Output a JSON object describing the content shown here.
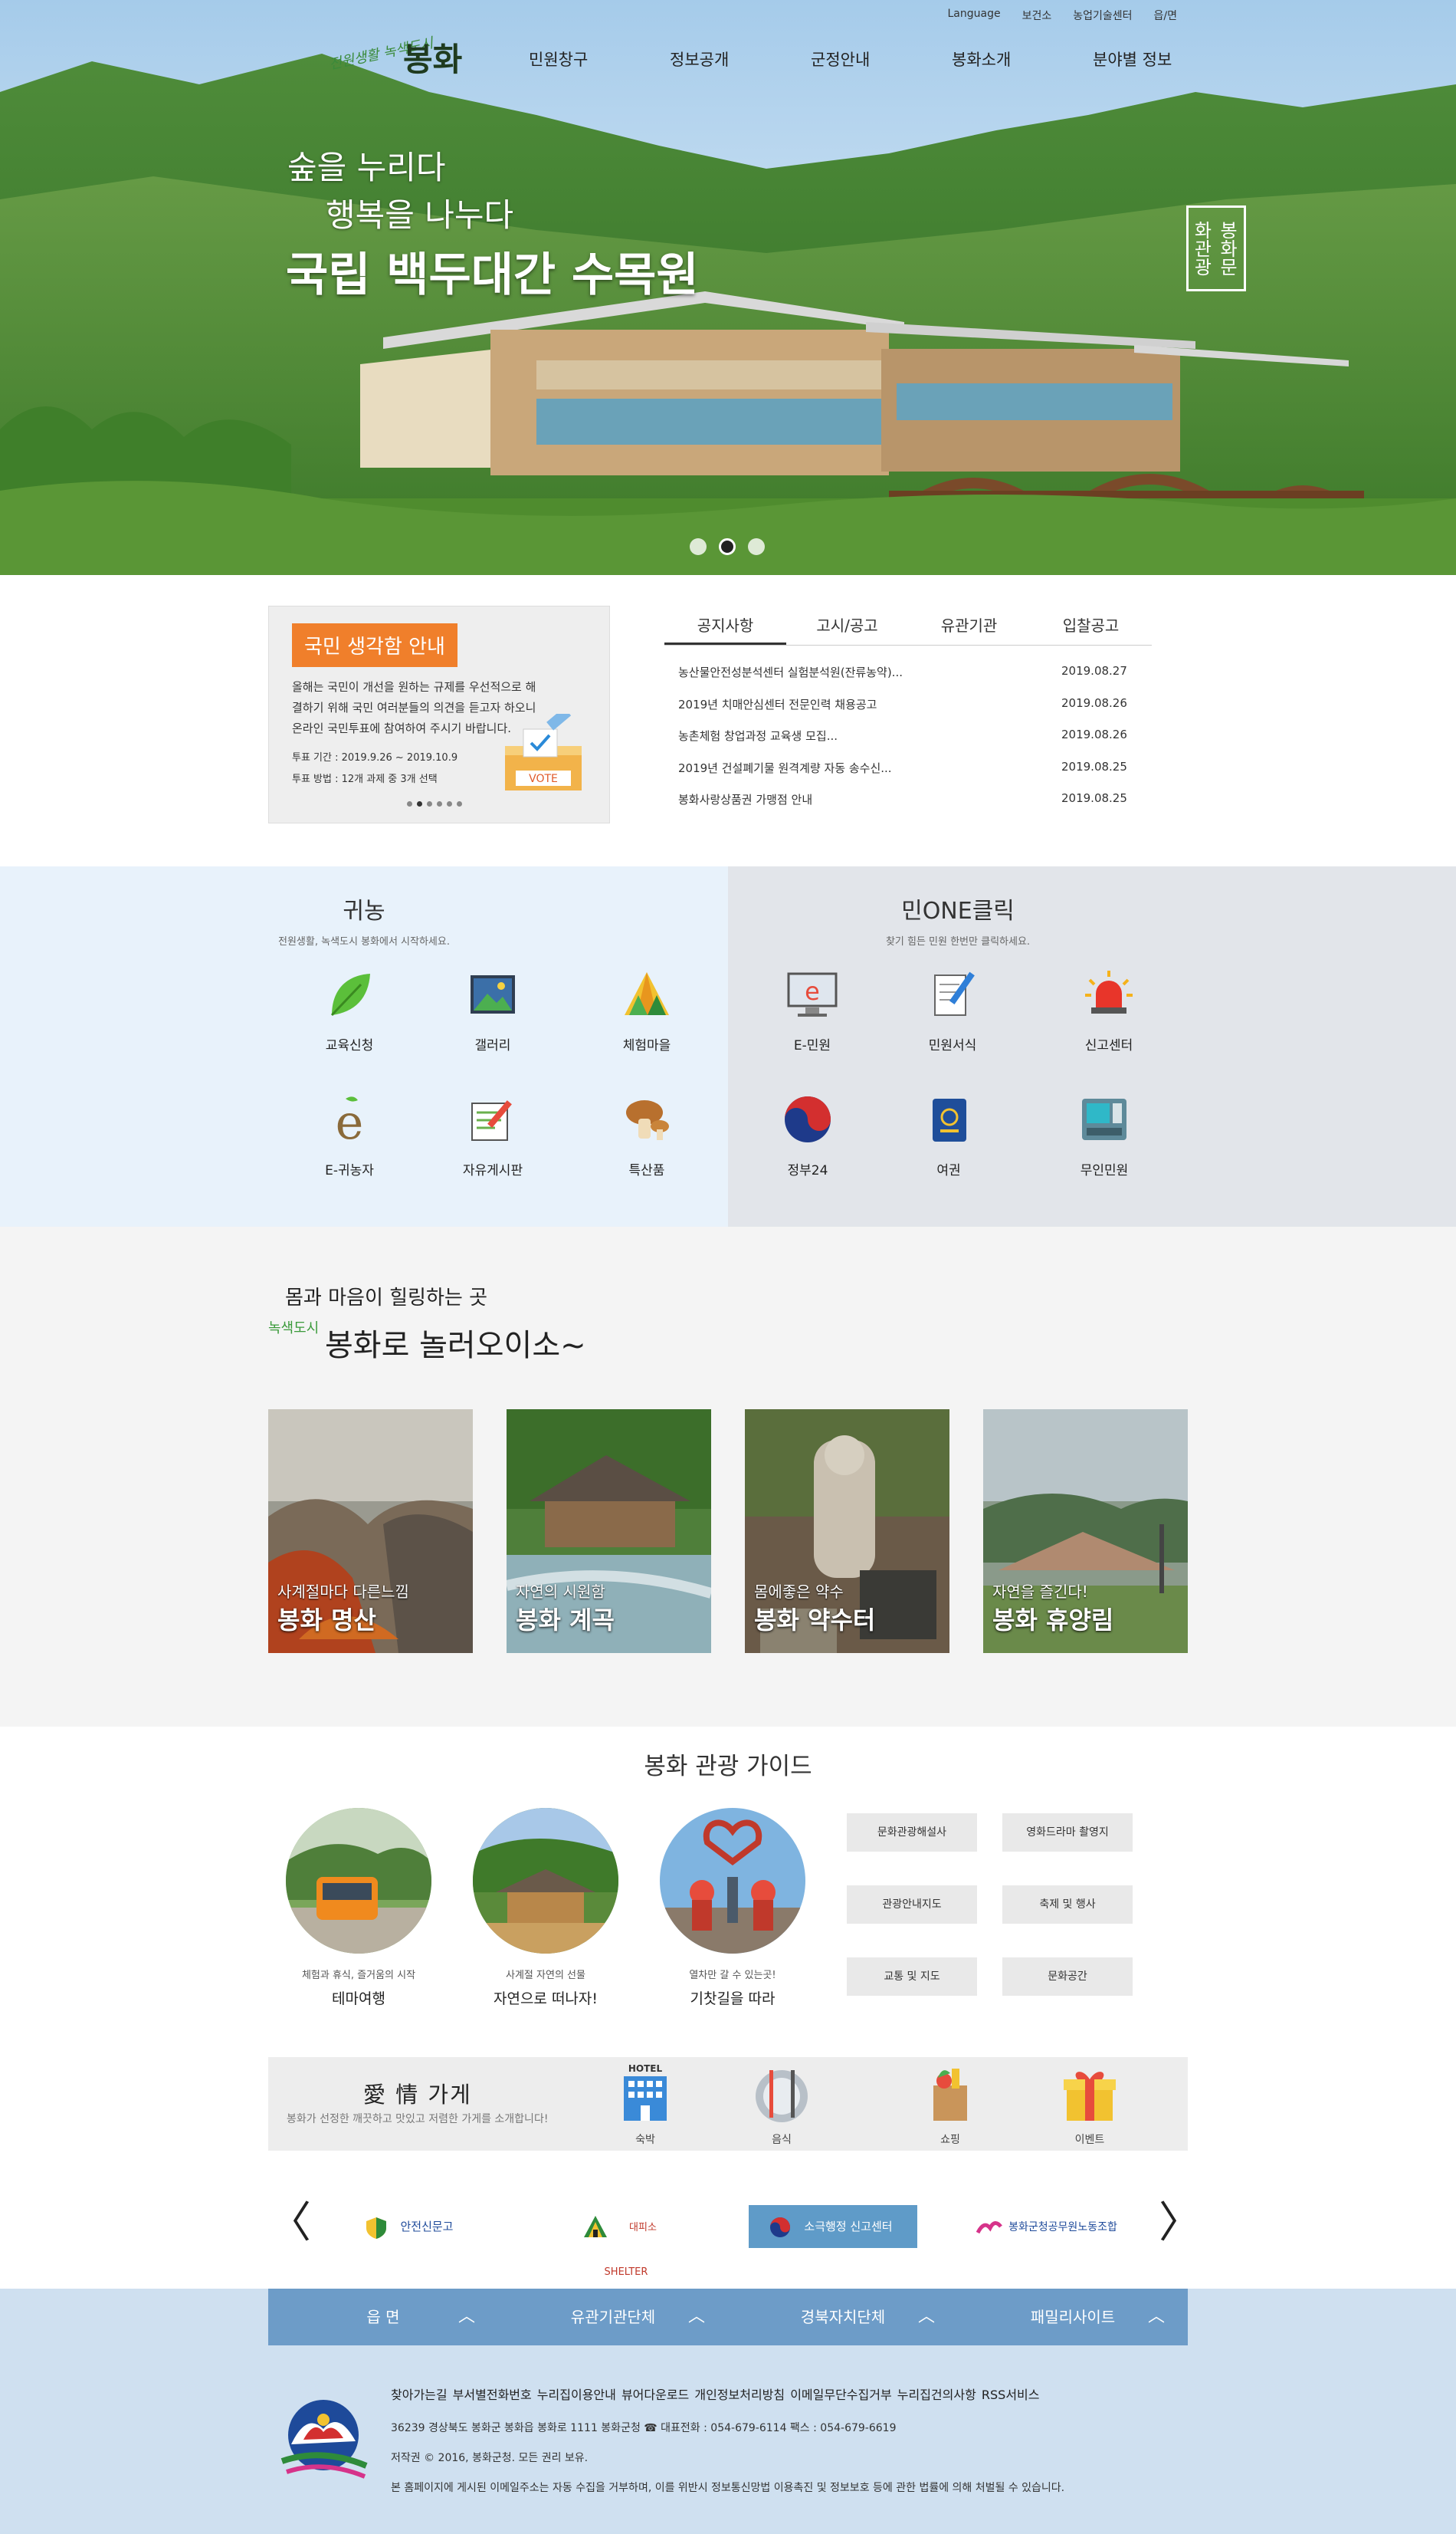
{
  "header": {
    "utility_links": [
      "Language",
      "보건소",
      "농업기술센터",
      "읍/면"
    ],
    "logo_script": "전원생활 녹색도시",
    "logo_text": "봉화",
    "gnb": [
      "민원창구",
      "정보공개",
      "군정안내",
      "봉화소개",
      "분야별 정보"
    ]
  },
  "hero": {
    "line1": "숲을 누리다",
    "line2": "행복을 나누다",
    "line3": "국립 백두대간 수목원",
    "stamp": "봉화문화관광",
    "slide_count": 3,
    "active_slide": 2
  },
  "notice_box": {
    "tag": "국민 생각함 안내",
    "desc": "올해는 국민이 개선을 원하는 규제를 우선적으로 해결하기 위해 국민 여러분들의 의견을 듣고자 하오니 온라인 국민투표에 참여하여 주시기 바랍니다.",
    "period": "투표 기간 : 2019.9.26 ~ 2019.10.9",
    "method": "투표 방법 : 12개 과제 중 3개 선택",
    "vote_label": "VOTE",
    "page_dots": 6,
    "active_dot": 2
  },
  "news": {
    "tabs": [
      "공지사항",
      "고시/공고",
      "유관기관",
      "입찰공고"
    ],
    "active_tab": 0,
    "items": [
      {
        "title": "농산물안전성분석센터 실험분석원(잔류농약)...",
        "date": "2019.08.27"
      },
      {
        "title": "2019년 치매안심센터 전문인력 채용공고",
        "date": "2019.08.26"
      },
      {
        "title": "농촌체험 창업과정 교육생 모집...",
        "date": "2019.08.26"
      },
      {
        "title": "2019년 건설폐기물 원격계량 자동 송수신...",
        "date": "2019.08.25"
      },
      {
        "title": "봉화사랑상품권 가맹점 안내",
        "date": "2019.08.25"
      }
    ]
  },
  "gwinong": {
    "title": "귀농",
    "subtitle": "전원생활, 녹색도시 봉화에서 시작하세요.",
    "items": [
      "교육신청",
      "갤러리",
      "체험마을",
      "E-귀농자",
      "자유게시판",
      "특산품"
    ]
  },
  "minone": {
    "title": "민ONE클릭",
    "subtitle": "찾기 힘든 민원 한번만 클릭하세요.",
    "items": [
      "E-민원",
      "민원서식",
      "신고센터",
      "정부24",
      "여권",
      "무인민원"
    ]
  },
  "healing": {
    "line1": "몸과 마음이 힐링하는 곳",
    "tag": "녹색도시",
    "line2": "봉화로 놀러오이소~",
    "cards": [
      {
        "sub": "사계절마다 다른느낌",
        "title": "봉화 명산"
      },
      {
        "sub": "자연의 시원함",
        "title": "봉화 계곡"
      },
      {
        "sub": "몸에좋은 약수",
        "title": "봉화 약수터"
      },
      {
        "sub": "자연을 즐긴다!",
        "title": "봉화 휴양림"
      }
    ]
  },
  "guide": {
    "title": "봉화 관광 가이드",
    "circles": [
      {
        "sub": "체험과 휴식, 즐거움의 시작",
        "title": "테마여행"
      },
      {
        "sub": "사계절 자연의 선물",
        "title": "자연으로 떠나자!"
      },
      {
        "sub": "열차만 갈 수 있는곳!",
        "title": "기찻길을 따라"
      }
    ],
    "buttons": [
      "문화관광해설사",
      "영화드라마 촬영지",
      "관광안내지도",
      "축제 및 행사",
      "교통 및 지도",
      "문화공간"
    ]
  },
  "shop": {
    "title": "愛 情 가게",
    "subtitle": "봉화가 선정한 깨끗하고 맛있고 저렴한 가게를 소개합니다!",
    "hotel_sign": "HOTEL",
    "items": [
      "숙박",
      "음식",
      "쇼핑",
      "이벤트"
    ]
  },
  "banners": {
    "prev": "〈",
    "next": "〉",
    "items": [
      "안전신문고",
      "대피소 SHELTER",
      "소극행정 신고센터",
      "봉화군청공무원노동조합"
    ]
  },
  "footer": {
    "nav": [
      "읍 면",
      "유관기관단체",
      "경북자치단체",
      "패밀리사이트"
    ],
    "links": "찾아가는길  부서별전화번호  누리집이용안내  뷰어다운로드  개인정보처리방침  이메일무단수집거부  누리집건의사항  RSS서비스",
    "address": "36239 경상북도 봉화군 봉화읍 봉화로 1111 봉화군청 ☎ 대표전화 : 054-679-6114 팩스 : 054-679-6619",
    "copyright": "저작권 © 2016, 봉화군청. 모든 권리 보유.",
    "notice": "본 홈페이지에 게시된 이메일주소는 자동 수집을 거부하며, 이를 위반시 정보통신망법 이용촉진 및 정보보호 등에 관한 법률에 의해 처벌될 수 있습니다."
  },
  "colors": {
    "accent_orange": "#f07f2b",
    "banner_blue": "#5f9bc8",
    "footer_nav": "#6d9cc8",
    "footer_bg": "#cfe0f0",
    "panel_left": "#e8f2fb",
    "panel_right": "#e2e5ea"
  }
}
